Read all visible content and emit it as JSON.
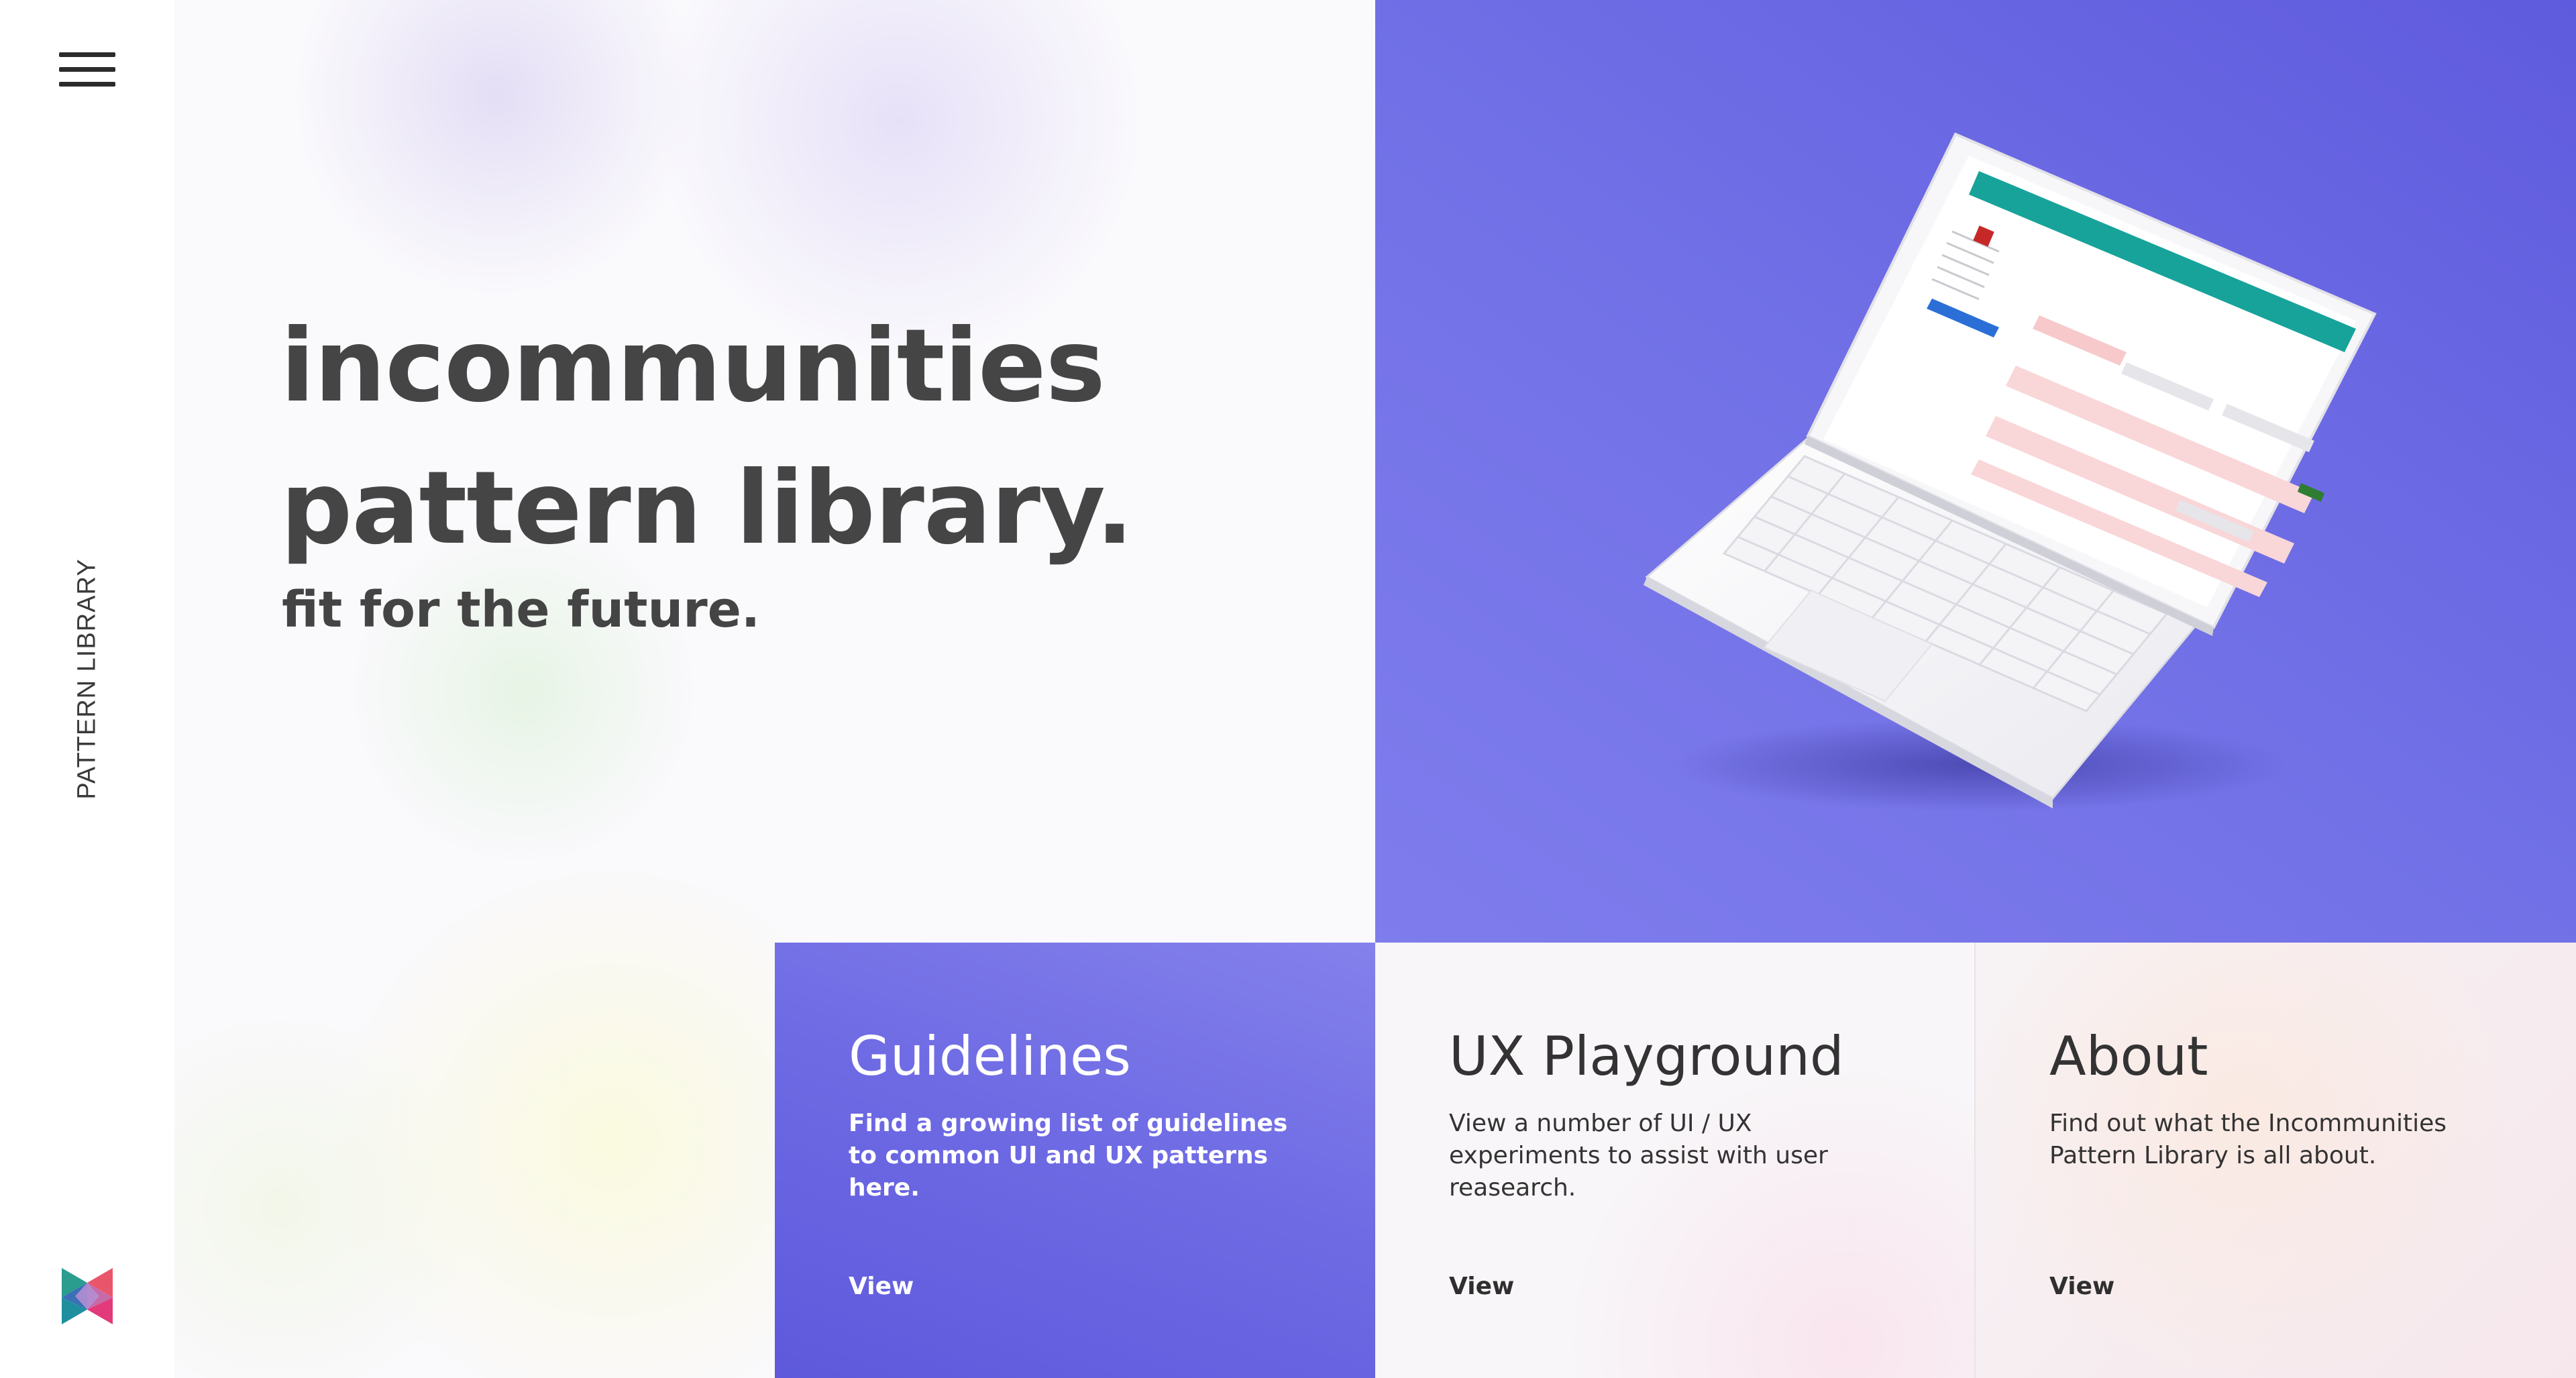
{
  "nav": {
    "side_label": "PATTERN LIBRARY"
  },
  "hero": {
    "title_line1": "incommunities",
    "title_line2": "pattern library.",
    "tagline": "fit for the future."
  },
  "cards": [
    {
      "title": "Guidelines",
      "description": "Find a growing list of guidelines to common UI and UX patterns here.",
      "link": "View"
    },
    {
      "title": "UX Playground",
      "description": "View a number of UI / UX experiments to assist with user reasearch.",
      "link": "View"
    },
    {
      "title": "About",
      "description": "Find out what the Incommunities Pattern Library is all about.",
      "link": "View"
    }
  ],
  "colors": {
    "accent_purple": "#6a66e2",
    "heading_gray": "#454545",
    "laptop_header_teal": "#17a39a"
  },
  "icons": [
    "menu-icon",
    "brand-logo",
    "laptop-mockup"
  ]
}
